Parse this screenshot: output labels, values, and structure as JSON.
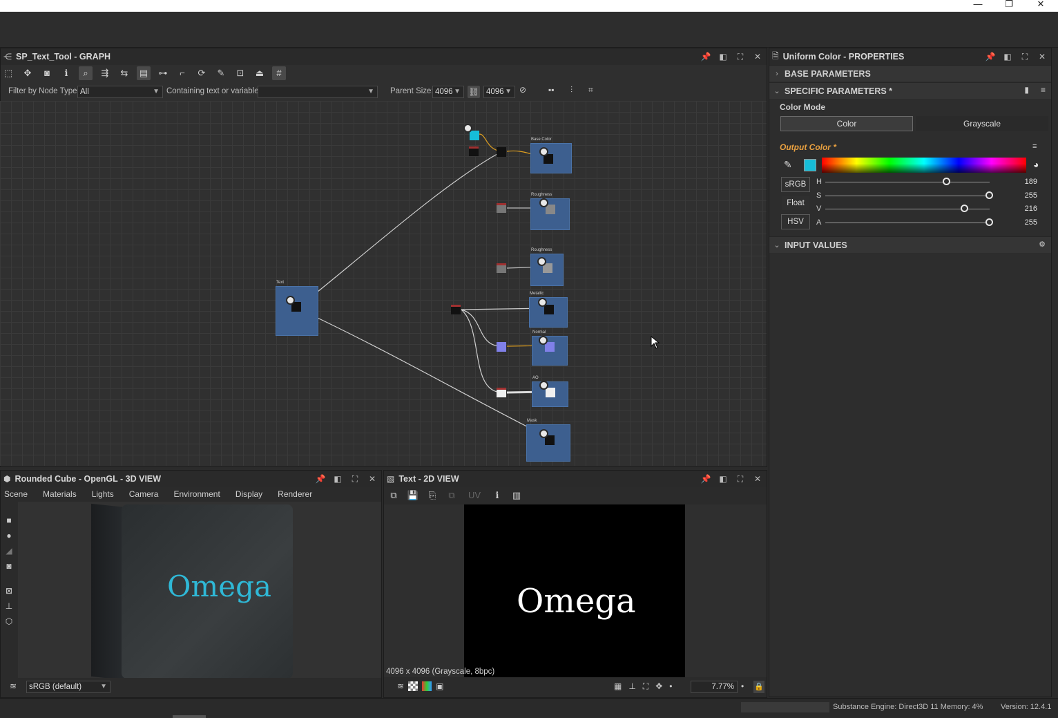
{
  "window": {
    "minimize": "—",
    "maximize": "❐",
    "close": "✕"
  },
  "graph_panel": {
    "title": "SP_Text_Tool - GRAPH",
    "filter_label": "Filter by Node Type",
    "filter_value": "All",
    "contains_label": "Containing text or variable",
    "contains_value": "",
    "parent_size_label": "Parent Size:",
    "parent_size_w": "4096",
    "parent_size_h": "4096"
  },
  "nodes": [
    {
      "label": "Base Color"
    },
    {
      "label": "Roughness"
    },
    {
      "label": "Roughness"
    },
    {
      "label": "Metallic"
    },
    {
      "label": "Normal"
    },
    {
      "label": "AO"
    },
    {
      "label": "Mask"
    },
    {
      "label": "Text"
    }
  ],
  "properties_panel": {
    "title": "Uniform Color - PROPERTIES",
    "base_parameters": "BASE PARAMETERS",
    "specific_parameters": "SPECIFIC PARAMETERS *",
    "color_mode_label": "Color Mode",
    "color_mode_options": [
      "Color",
      "Grayscale"
    ],
    "output_color_label": "Output Color *",
    "output_color_hex": "#16bdd8",
    "mode_buttons": [
      "sRGB",
      "Float",
      "HSV"
    ],
    "channels": [
      {
        "name": "H",
        "value": "189",
        "fraction": 0.74
      },
      {
        "name": "S",
        "value": "255",
        "fraction": 1.0
      },
      {
        "name": "V",
        "value": "216",
        "fraction": 0.85
      },
      {
        "name": "A",
        "value": "255",
        "fraction": 1.0
      }
    ],
    "input_values": "INPUT VALUES"
  },
  "view3d": {
    "title": "Rounded Cube - OpenGL - 3D VIEW",
    "menu": [
      "Scene",
      "Materials",
      "Lights",
      "Camera",
      "Environment",
      "Display",
      "Renderer"
    ],
    "cube_text": "Omega",
    "colorspace": "sRGB (default)"
  },
  "view2d": {
    "title": "Text - 2D VIEW",
    "uv_label": "UV",
    "image_text": "Omega",
    "image_info": "4096 x 4096 (Grayscale, 8bpc)",
    "zoom": "7.77%"
  },
  "status": {
    "engine": "Substance Engine: Direct3D 11  Memory: 4%",
    "version": "Version: 12.4.1"
  }
}
